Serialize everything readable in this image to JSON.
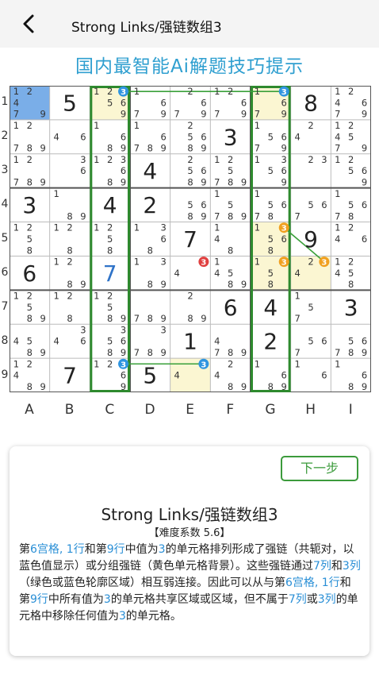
{
  "header": {
    "title": "Strong Links/强链数组3"
  },
  "banner": "国内最智能Ai解题技巧提示",
  "columns": [
    "A",
    "B",
    "C",
    "D",
    "E",
    "F",
    "G",
    "H",
    "I"
  ],
  "rows": [
    "1",
    "2",
    "3",
    "4",
    "5",
    "6",
    "7",
    "8",
    "9"
  ],
  "colors": {
    "blue": "#2f95e0",
    "orange": "#f0a020",
    "red": "#e04040",
    "green": "#2e8a2e",
    "yellow": "#fbf6d2",
    "selected": "#7aaee8",
    "link": "#3aa03a",
    "given": "#222222",
    "placed": "#2f73c8"
  },
  "grid": [
    [
      {
        "c": "12479",
        "b": "s"
      },
      {
        "v": "5"
      },
      {
        "c": "123569",
        "y": 1,
        "b": {
          "3": "blue"
        }
      },
      {
        "c": "1679"
      },
      {
        "c": "2679"
      },
      {
        "c": "12679"
      },
      {
        "c": "13679",
        "y": 1,
        "b": {
          "3": "blue"
        }
      },
      {
        "v": "8"
      },
      {
        "c": "124679"
      }
    ],
    [
      {
        "c": "12789"
      },
      {
        "c": "46"
      },
      {
        "c": "1689"
      },
      {
        "c": "16789"
      },
      {
        "c": "25689"
      },
      {
        "v": "3"
      },
      {
        "c": "15679"
      },
      {
        "c": "24"
      },
      {
        "c": "124579"
      }
    ],
    [
      {
        "c": "12789"
      },
      {
        "c": "36"
      },
      {
        "c": "123689"
      },
      {
        "v": "4"
      },
      {
        "c": "25689"
      },
      {
        "c": "125789"
      },
      {
        "c": "13569"
      },
      {
        "c": "23"
      },
      {
        "c": "12569"
      }
    ],
    [
      {
        "v": "3"
      },
      {
        "c": "189"
      },
      {
        "v": "4"
      },
      {
        "v": "2"
      },
      {
        "c": "5689"
      },
      {
        "c": "15789"
      },
      {
        "c": "15678"
      },
      {
        "c": "567"
      },
      {
        "c": "15678"
      }
    ],
    [
      {
        "c": "1258"
      },
      {
        "c": "128"
      },
      {
        "c": "1258"
      },
      {
        "c": "1368"
      },
      {
        "v": "7"
      },
      {
        "c": "148"
      },
      {
        "c": "13568",
        "y": 1,
        "b": {
          "3": "orange"
        }
      },
      {
        "v": "9"
      },
      {
        "c": "1246"
      }
    ],
    [
      {
        "v": "6"
      },
      {
        "c": "1289"
      },
      {
        "v": "7",
        "p": 1
      },
      {
        "c": "1389"
      },
      {
        "c": "34",
        "b": {
          "3": "red"
        }
      },
      {
        "c": "14589"
      },
      {
        "c": "1358",
        "y": 1,
        "b": {
          "3": "orange"
        }
      },
      {
        "c": "234",
        "y": 1,
        "b": {
          "3": "orange"
        }
      },
      {
        "c": "12458"
      }
    ],
    [
      {
        "c": "12589"
      },
      {
        "c": "128"
      },
      {
        "c": "12589"
      },
      {
        "c": "789"
      },
      {
        "c": "289"
      },
      {
        "v": "6"
      },
      {
        "v": "4"
      },
      {
        "c": "157"
      },
      {
        "v": "3"
      }
    ],
    [
      {
        "c": "4589"
      },
      {
        "c": "346"
      },
      {
        "c": "35689"
      },
      {
        "c": "3789"
      },
      {
        "v": "1"
      },
      {
        "c": "4789"
      },
      {
        "v": "2"
      },
      {
        "c": "567"
      },
      {
        "c": "56789"
      }
    ],
    [
      {
        "c": "12489"
      },
      {
        "v": "7"
      },
      {
        "c": "12369",
        "b": {
          "3": "blue"
        }
      },
      {
        "v": "5"
      },
      {
        "c": "34",
        "y": 1,
        "b": {
          "3": "blue"
        }
      },
      {
        "c": "2489"
      },
      {
        "c": "1689"
      },
      {
        "c": "16"
      },
      {
        "c": "1689"
      }
    ]
  ],
  "links": [
    {
      "type": "strong",
      "from": [
        0,
        2,
        3
      ],
      "to": [
        0,
        6,
        3
      ]
    },
    {
      "type": "strong",
      "from": [
        8,
        2,
        3
      ],
      "to": [
        8,
        4,
        3
      ]
    },
    {
      "type": "weak",
      "from": [
        4,
        6,
        3
      ],
      "to": [
        5,
        7,
        3
      ]
    }
  ],
  "outlined_columns": [
    2,
    6
  ],
  "card": {
    "next_label": "下一步",
    "title": "Strong Links/强链数组3",
    "difficulty": "【难度系数 5.6】",
    "desc": [
      {
        "t": "第"
      },
      {
        "t": "6宫格, 1行",
        "h": 1
      },
      {
        "t": "和第"
      },
      {
        "t": "9行",
        "h": 1
      },
      {
        "t": "中值为"
      },
      {
        "t": "3",
        "h": 1
      },
      {
        "t": "的单元格排列形成了强链（共轭对，以蓝色值显示）或分组强链（黄色单元格背景）。这些强链通过"
      },
      {
        "t": "7列",
        "h": 1
      },
      {
        "t": "和"
      },
      {
        "t": "3列",
        "h": 1
      },
      {
        "t": "（绿色或蓝色轮廓区域）相互弱连接。因此可以从与第"
      },
      {
        "t": "6宫格, 1行",
        "h": 1
      },
      {
        "t": "和第"
      },
      {
        "t": "9行",
        "h": 1
      },
      {
        "t": "中所有值为"
      },
      {
        "t": "3",
        "h": 1
      },
      {
        "t": "的单元格共享区域或区域，但不属于"
      },
      {
        "t": "7列",
        "h": 1
      },
      {
        "t": "或"
      },
      {
        "t": "3列",
        "h": 1
      },
      {
        "t": "的单元格中移除任何值为"
      },
      {
        "t": "3",
        "h": 1
      },
      {
        "t": "的单元格。"
      }
    ]
  }
}
